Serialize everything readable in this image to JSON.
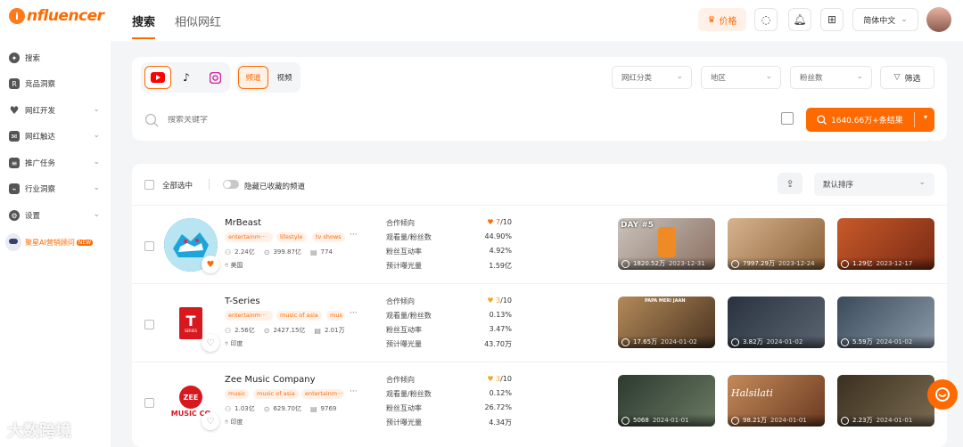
{
  "brand": {
    "logo_text": "nfluencer",
    "logo_mark": "i"
  },
  "sidebar": {
    "items": [
      {
        "label": "搜索",
        "icon": "compass-icon",
        "chevron": false
      },
      {
        "label": "竞品洞察",
        "icon": "r-badge-icon",
        "chevron": false
      },
      {
        "label": "网红开发",
        "icon": "heart-icon",
        "chevron": true
      },
      {
        "label": "网红触达",
        "icon": "mail-icon",
        "chevron": true
      },
      {
        "label": "推广任务",
        "icon": "clipboard-icon",
        "chevron": true
      },
      {
        "label": "行业洞察",
        "icon": "chart-icon",
        "chevron": true
      },
      {
        "label": "设置",
        "icon": "gear-icon",
        "chevron": true
      }
    ],
    "ai_label": "聚星AI营销顾问",
    "ai_badge": "NEW"
  },
  "header": {
    "tabs": [
      "搜索",
      "相似网红"
    ],
    "price_label": "价格",
    "language": "简体中文"
  },
  "filters": {
    "platforms": [
      "youtube-icon",
      "tiktok-icon",
      "instagram-icon"
    ],
    "types": [
      "频道",
      "视频"
    ],
    "category_placeholder": "网红分类",
    "region_placeholder": "地区",
    "followers_placeholder": "粉丝数",
    "filter_label": "筛选",
    "search_placeholder": "搜索关键字",
    "result_label": "1640.66万+条结果"
  },
  "toolbar": {
    "select_all": "全部选中",
    "hide_saved": "隐藏已收藏的频道",
    "sort_label": "默认排序"
  },
  "metric_labels": [
    "合作倾向",
    "观看量/粉丝数",
    "粉丝互动率",
    "预计曝光量"
  ],
  "channels": [
    {
      "name": "MrBeast",
      "tags": [
        "entertainm···",
        "lifestyle",
        "tv shows"
      ],
      "subscribers": "2.24亿",
      "views": "399.87亿",
      "videos": "774",
      "location": "美国",
      "score": "7",
      "score_max": "/10",
      "view_ratio": "44.90%",
      "engagement": "4.92%",
      "exposure": "1.59亿",
      "favorited": true,
      "videos_list": [
        {
          "views": "1820.52万",
          "date": "2023-12-31",
          "overlay": "DAY #5"
        },
        {
          "views": "7997.29万",
          "date": "2023-12-24",
          "overlay": ""
        },
        {
          "views": "1.29亿",
          "date": "2023-12-17",
          "overlay": ""
        }
      ]
    },
    {
      "name": "T-Series",
      "tags": [
        "entertainm···",
        "music of asia",
        "mus"
      ],
      "subscribers": "2.56亿",
      "views": "2427.15亿",
      "videos": "2.01万",
      "location": "印度",
      "score": "3",
      "score_max": "/10",
      "view_ratio": "0.13%",
      "engagement": "3.47%",
      "exposure": "43.70万",
      "favorited": false,
      "logo_text": "T",
      "logo_sub": "SERIES",
      "videos_list": [
        {
          "views": "17.65万",
          "date": "2024-01-02",
          "overlay": "PAPA MERI JAAN"
        },
        {
          "views": "3.82万",
          "date": "2024-01-02",
          "overlay": ""
        },
        {
          "views": "5.59万",
          "date": "2024-01-02",
          "overlay": ""
        }
      ]
    },
    {
      "name": "Zee Music Company",
      "tags": [
        "music",
        "music of asia",
        "entertainm···"
      ],
      "subscribers": "1.03亿",
      "views": "629.70亿",
      "videos": "9769",
      "location": "印度",
      "score": "3",
      "score_max": "/10",
      "view_ratio": "0.12%",
      "engagement": "26.72%",
      "exposure": "4.34万",
      "favorited": false,
      "logo_text": "ZEE",
      "logo_sub": "MUSIC CO",
      "videos_list": [
        {
          "views": "5068",
          "date": "2024-01-01",
          "overlay": ""
        },
        {
          "views": "98.21万",
          "date": "2024-01-01",
          "overlay": "Halsilati"
        },
        {
          "views": "2.23万",
          "date": "2024-01-01",
          "overlay": ""
        }
      ]
    }
  ],
  "watermark": "大数跨境",
  "colors": {
    "accent": "#ff6a00",
    "accent_light": "#fff1e8"
  }
}
